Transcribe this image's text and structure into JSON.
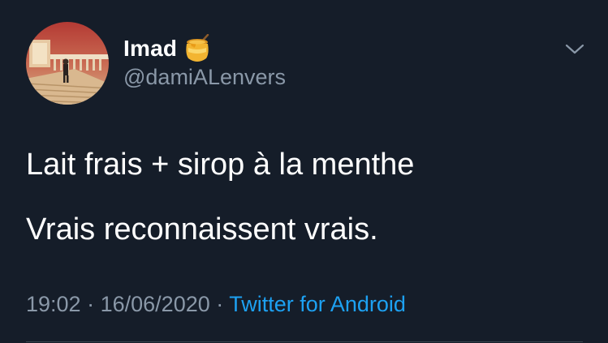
{
  "author": {
    "display_name": "Imad",
    "handle": "@damiALenvers",
    "name_emoji": "honey-pot-icon"
  },
  "tweet": {
    "lines": [
      "Lait frais + sirop à la menthe",
      "Vrais reconnaissent vrais."
    ]
  },
  "meta": {
    "time": "19:02",
    "separator_1": "·",
    "date": "16/06/2020",
    "separator_2": "·",
    "source": "Twitter for Android"
  },
  "icons": {
    "menu": "chevron-down-icon",
    "avatar": "avatar"
  },
  "colors": {
    "background": "#151d29",
    "secondary_text": "#8a98a8",
    "link": "#1da1f2"
  }
}
